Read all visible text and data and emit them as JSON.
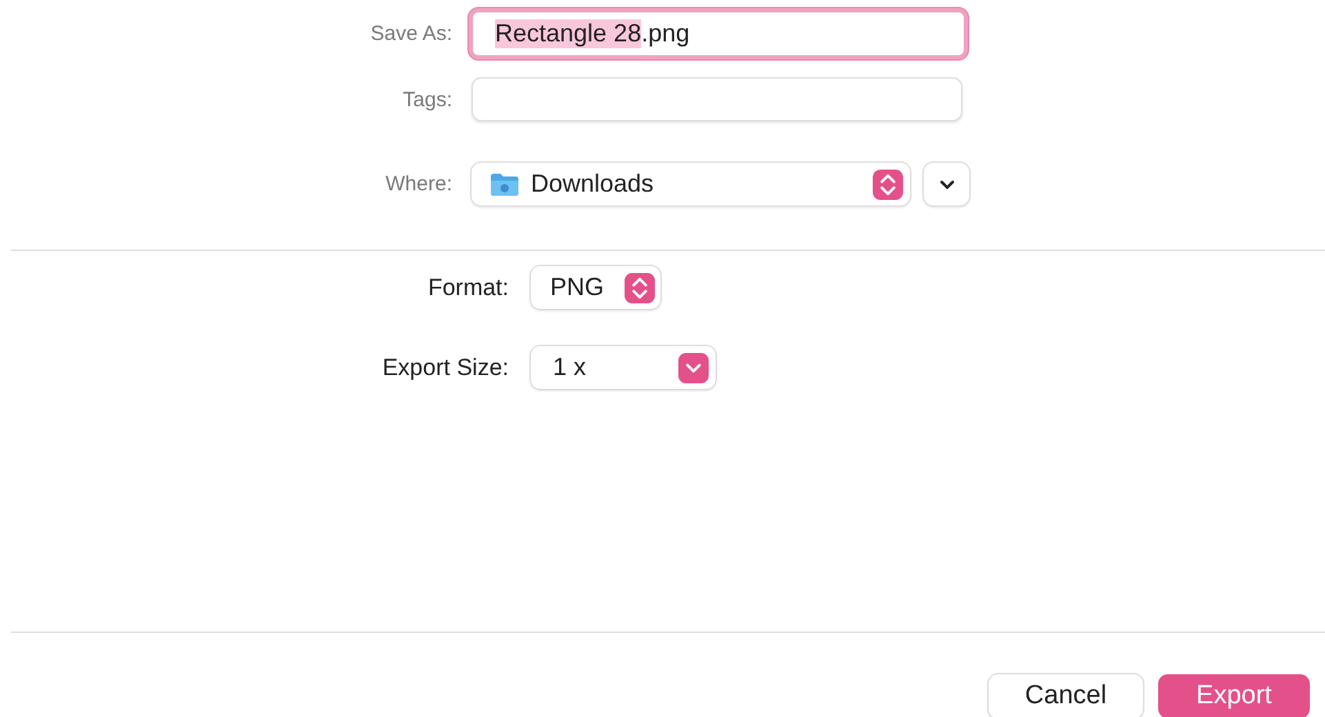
{
  "save_as": {
    "label": "Save As:",
    "selected_text": "Rectangle 28",
    "rest_text": ".png",
    "focused": true
  },
  "tags": {
    "label": "Tags:"
  },
  "where": {
    "label": "Where:",
    "value": "Downloads"
  },
  "format": {
    "label": "Format:",
    "value": "PNG"
  },
  "export_size": {
    "label": "Export Size:",
    "value": "1 x"
  },
  "buttons": [
    {
      "label": "Cancel",
      "kind": "secondary"
    },
    {
      "label": "Export",
      "kind": "primary"
    }
  ]
}
